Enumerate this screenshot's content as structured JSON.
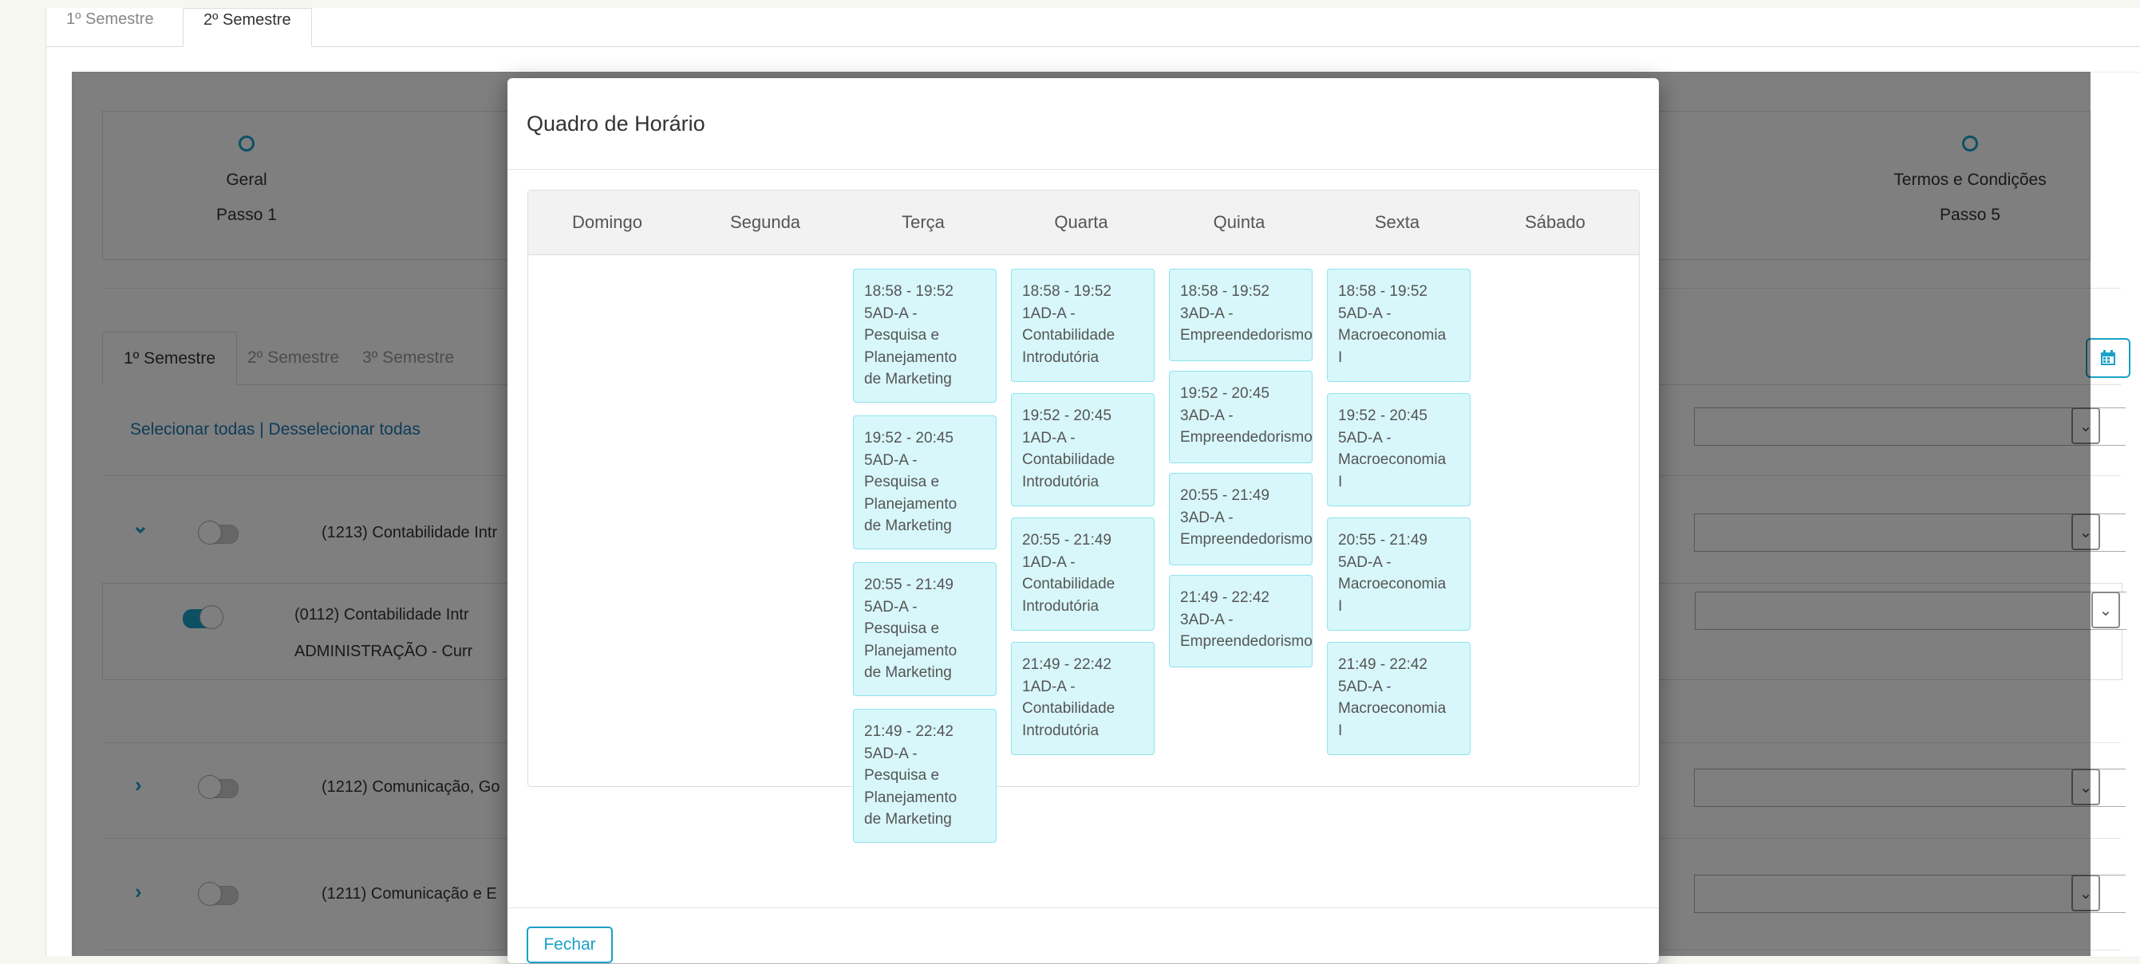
{
  "outer_tabs": [
    "1º Semestre",
    "2º Semestre"
  ],
  "steps": [
    {
      "label": "Geral",
      "sub": "Passo 1"
    },
    {
      "label": "Termos e Condições",
      "sub": "Passo 5"
    }
  ],
  "semester_tabs": [
    "1º Semestre",
    "2º Semestre",
    "3º Semestre"
  ],
  "select_links": "Selecionar todas | Desselecionar todas",
  "courses": [
    {
      "text": "(1213) Contabilidade Intr"
    },
    {
      "text": "(0112) Contabilidade Intr",
      "sub": "ADMINISTRAÇÃO - Curr"
    },
    {
      "text": "(1212) Comunicação, Go"
    },
    {
      "text": "(1211) Comunicação e E"
    }
  ],
  "modal": {
    "title": "Quadro de Horário",
    "close_label": "Fechar",
    "days": [
      "Domingo",
      "Segunda",
      "Terça",
      "Quarta",
      "Quinta",
      "Sexta",
      "Sábado"
    ],
    "slots": {
      "terca": [
        "18:58 - 19:52\n5AD-A -\nPesquisa e\nPlanejamento\nde Marketing",
        "19:52 - 20:45\n5AD-A -\nPesquisa e\nPlanejamento\nde Marketing",
        "20:55 - 21:49\n5AD-A -\nPesquisa e\nPlanejamento\nde Marketing",
        "21:49 - 22:42\n5AD-A -\nPesquisa e\nPlanejamento\nde Marketing"
      ],
      "quarta": [
        "18:58 - 19:52\n1AD-A -\nContabilidade\nIntrodutória",
        "19:52 - 20:45\n1AD-A -\nContabilidade\nIntrodutória",
        "20:55 - 21:49\n1AD-A -\nContabilidade\nIntrodutória",
        "21:49 - 22:42\n1AD-A -\nContabilidade\nIntrodutória"
      ],
      "quinta": [
        "18:58 - 19:52\n3AD-A -\nEmpreendedorismo",
        "19:52 - 20:45\n3AD-A -\nEmpreendedorismo",
        "20:55 - 21:49\n3AD-A -\nEmpreendedorismo",
        "21:49 - 22:42\n3AD-A -\nEmpreendedorismo"
      ],
      "sexta": [
        "18:58 - 19:52\n5AD-A -\nMacroeconomia\nI",
        "19:52 - 20:45\n5AD-A -\nMacroeconomia\nI",
        "20:55 - 21:49\n5AD-A -\nMacroeconomia\nI",
        "21:49 - 22:42\n5AD-A -\nMacroeconomia\nI"
      ]
    }
  }
}
